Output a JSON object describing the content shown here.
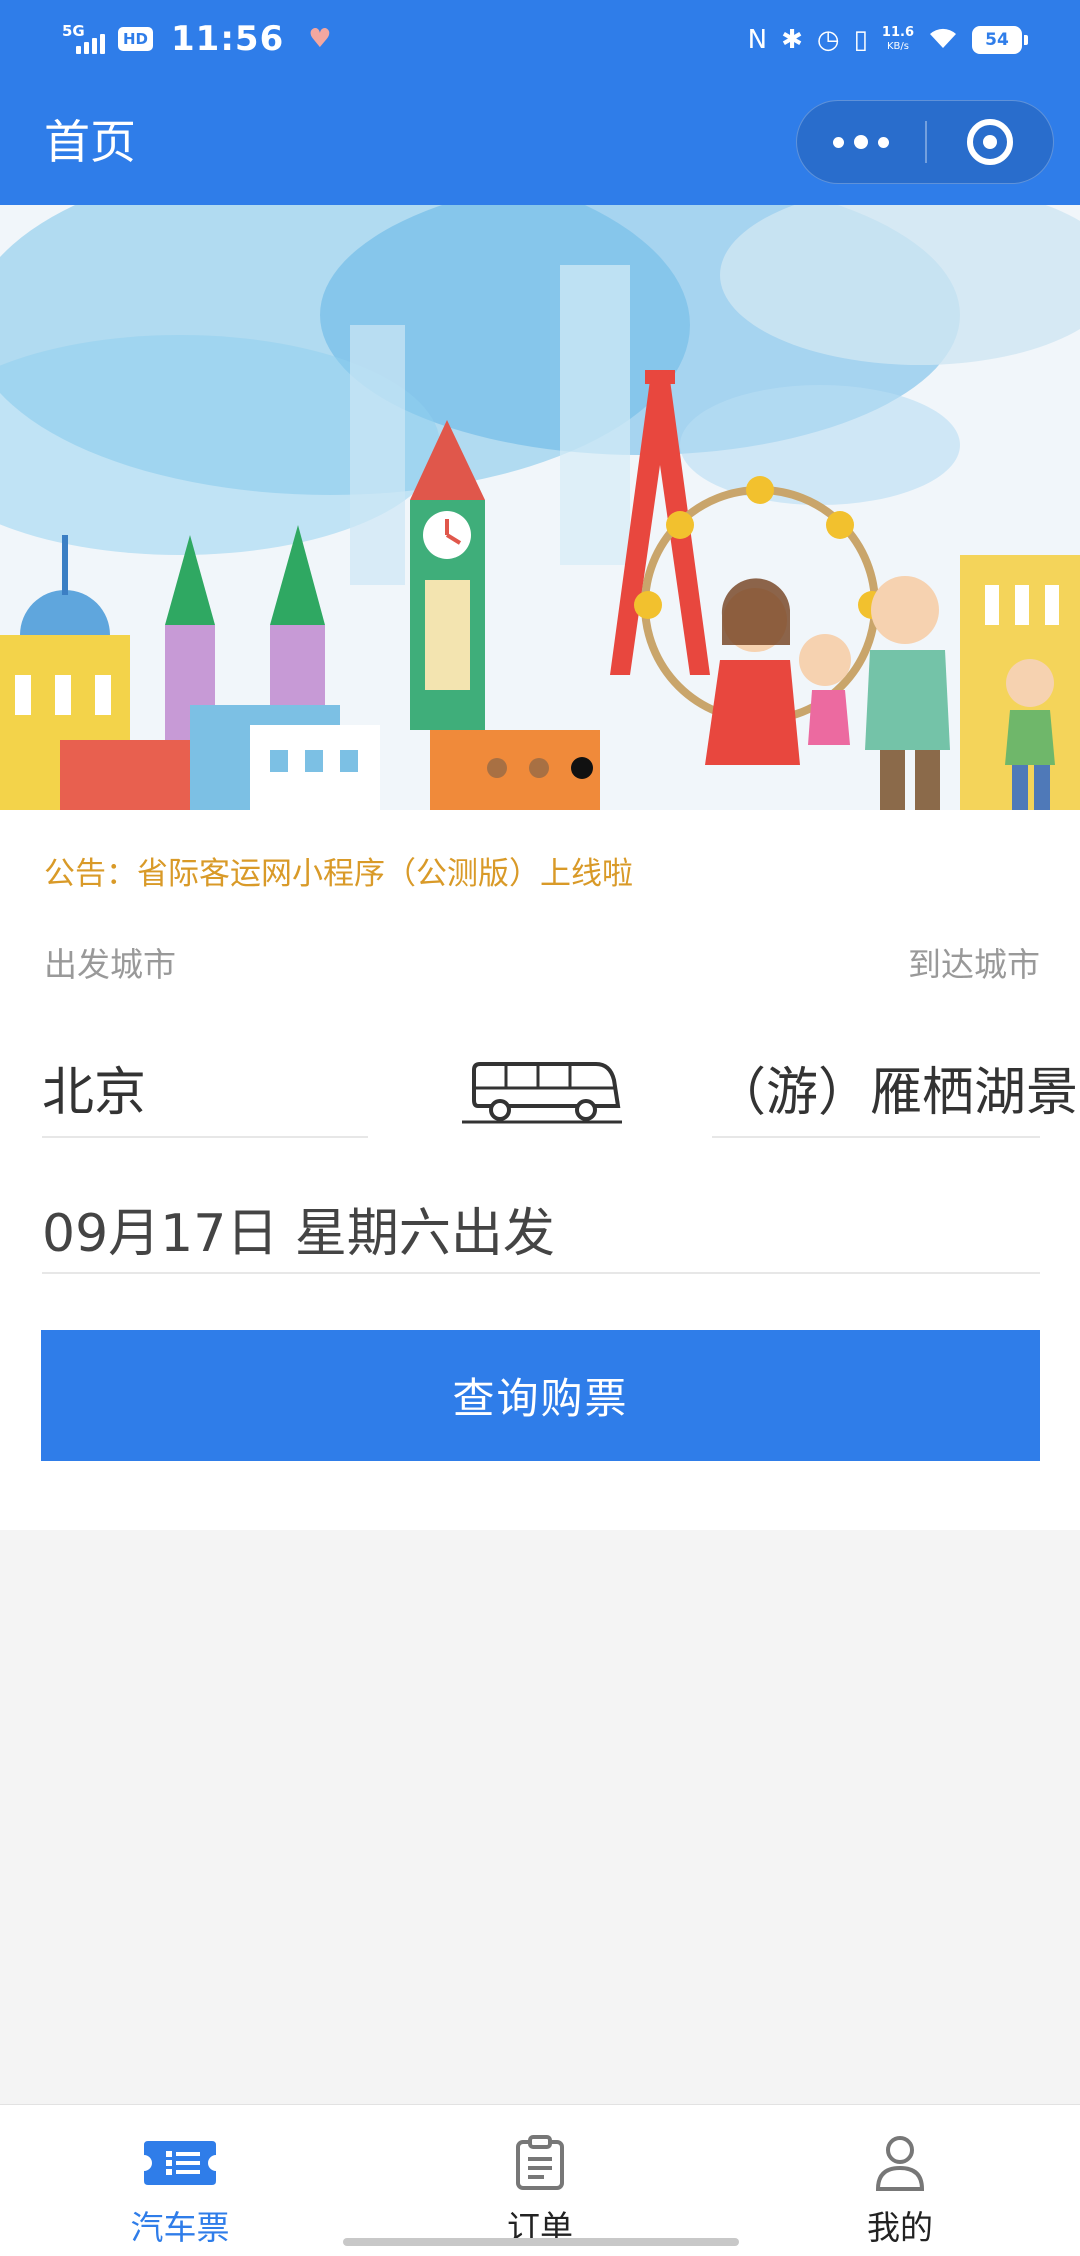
{
  "status_bar": {
    "network": "5G",
    "hd": "HD",
    "time": "11:56",
    "speed_value": "11.6",
    "speed_unit": "KB/s",
    "battery": "54"
  },
  "nav": {
    "title": "首页"
  },
  "banner": {
    "slide_count": 3,
    "active_slide": 3
  },
  "notice": {
    "text": "公告：省际客运网小程序（公测版）上线啦"
  },
  "form": {
    "from_label": "出发城市",
    "to_label": "到达城市",
    "from_city": "北京",
    "to_city": "（游）雁栖湖景",
    "date_text": "09月17日 星期六出发",
    "search_button": "查询购票"
  },
  "tabbar": {
    "items": [
      {
        "label": "汽车票",
        "icon": "ticket-icon",
        "active": true
      },
      {
        "label": "订单",
        "icon": "clipboard-icon",
        "active": false
      },
      {
        "label": "我的",
        "icon": "user-icon",
        "active": false
      }
    ]
  },
  "colors": {
    "primary": "#2f7de9",
    "notice": "#d99a28",
    "label": "#999999"
  }
}
